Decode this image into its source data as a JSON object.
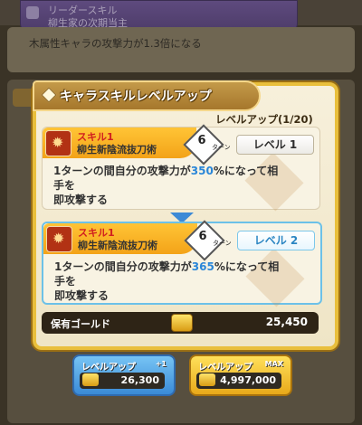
{
  "background": {
    "leader_title": "リーダースキル",
    "leader_name": "柳生家の次期当主",
    "leader_desc": "木属性キャラの攻撃力が1.3倍になる"
  },
  "modal": {
    "title": "キャラスキルレベルアップ",
    "progress": "レベルアップ(1/20)"
  },
  "current_skill": {
    "label": "スキル1",
    "name": "柳生新陰流抜刀術",
    "turns": "6",
    "turn_unit": "ターン",
    "level": "レベル 1",
    "desc_pre": "1ターンの間自分の攻撃力が",
    "desc_value": "350",
    "desc_post": "%になって相手を",
    "desc_line2": "即攻撃する"
  },
  "next_skill": {
    "label": "スキル1",
    "name": "柳生新陰流抜刀術",
    "turns": "6",
    "turn_unit": "ターン",
    "level": "レベル 2",
    "desc_pre": "1ターンの間自分の攻撃力が",
    "desc_value": "365",
    "desc_post": "%になって相手を",
    "desc_line2": "即攻撃する"
  },
  "gold": {
    "label": "保有ゴールド",
    "value": "25,450"
  },
  "buttons": {
    "plus1": {
      "title": "レベルアップ",
      "tag": "+1",
      "cost": "26,300"
    },
    "max": {
      "title": "レベルアップ",
      "tag": "MAX",
      "cost": "4,997,000"
    }
  },
  "colors": {
    "modal_border": "#e9bf3c",
    "skill_header": "#f3a318",
    "highlight_blue": "#2a86d8",
    "button_blue": "#3a8bd7",
    "button_gold": "#e8a91a"
  }
}
